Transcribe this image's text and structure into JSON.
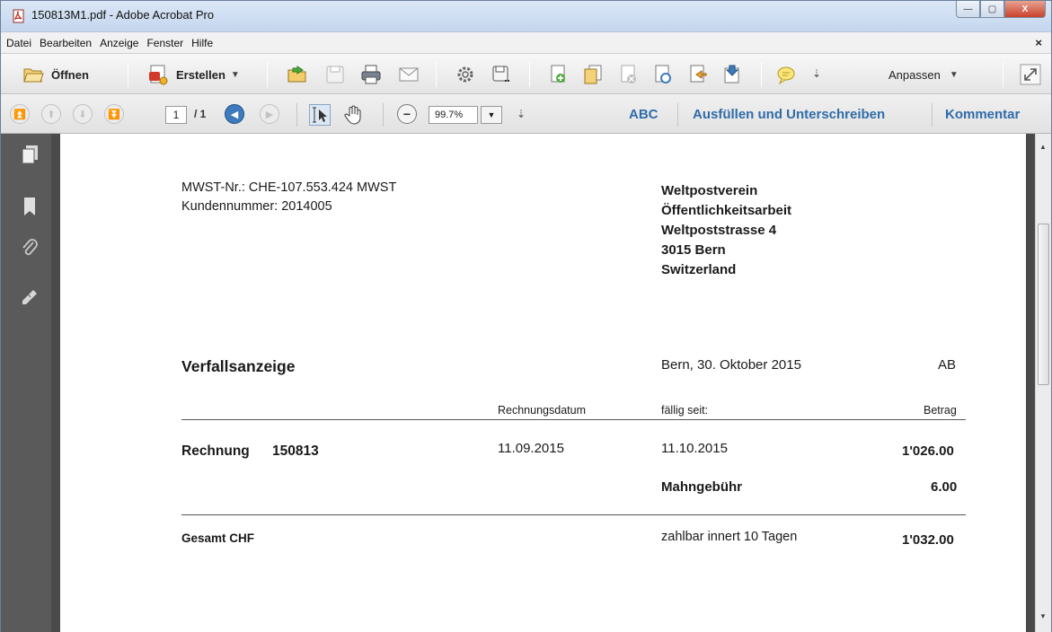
{
  "window": {
    "title": "150813M1.pdf - Adobe Acrobat Pro",
    "controls": {
      "minimize": "—",
      "maximize": "▢",
      "close": "X"
    }
  },
  "menubar": {
    "items": [
      "Datei",
      "Bearbeiten",
      "Anzeige",
      "Fenster",
      "Hilfe"
    ],
    "close": "×"
  },
  "toolbar1": {
    "open_label": "Öffnen",
    "create_label": "Erstellen",
    "customize_label": "Anpassen",
    "caret": "▼",
    "overflow": "⇣"
  },
  "toolbar2": {
    "page_current": "1",
    "page_total": "/ 1",
    "zoom": "99.7%",
    "zoom_caret": "▼",
    "overflow": "⇣",
    "tools_label": "ABC",
    "fill_sign_label": "Ausfüllen und Unterschreiben",
    "comment_label": "Kommentar"
  },
  "document": {
    "vat_number": "MWST-Nr.: CHE-107.553.424 MWST",
    "customer_number": "Kundennummer:  2014005",
    "recipient": {
      "line1": "Weltpostverein",
      "line2": "Öffentlichkeitsarbeit",
      "line3": "Weltpoststrasse 4",
      "line4": "3015 Bern",
      "line5": "Switzerland"
    },
    "heading": "Verfallsanzeige",
    "place_date": "Bern, 30. Oktober 2015",
    "initials": "AB",
    "table": {
      "col_invoice_date": "Rechnungsdatum",
      "col_due_since": "fällig seit:",
      "col_amount": "Betrag",
      "invoice_label": "Rechnung",
      "invoice_number": "150813",
      "invoice_date": "11.09.2015",
      "due_date": "11.10.2015",
      "invoice_amount": "1'026.00",
      "fee_label": "Mahngebühr",
      "fee_amount": "6.00",
      "total_label": "Gesamt CHF",
      "payment_terms": "zahlbar innert 10 Tagen",
      "total_amount": "1'032.00"
    }
  }
}
